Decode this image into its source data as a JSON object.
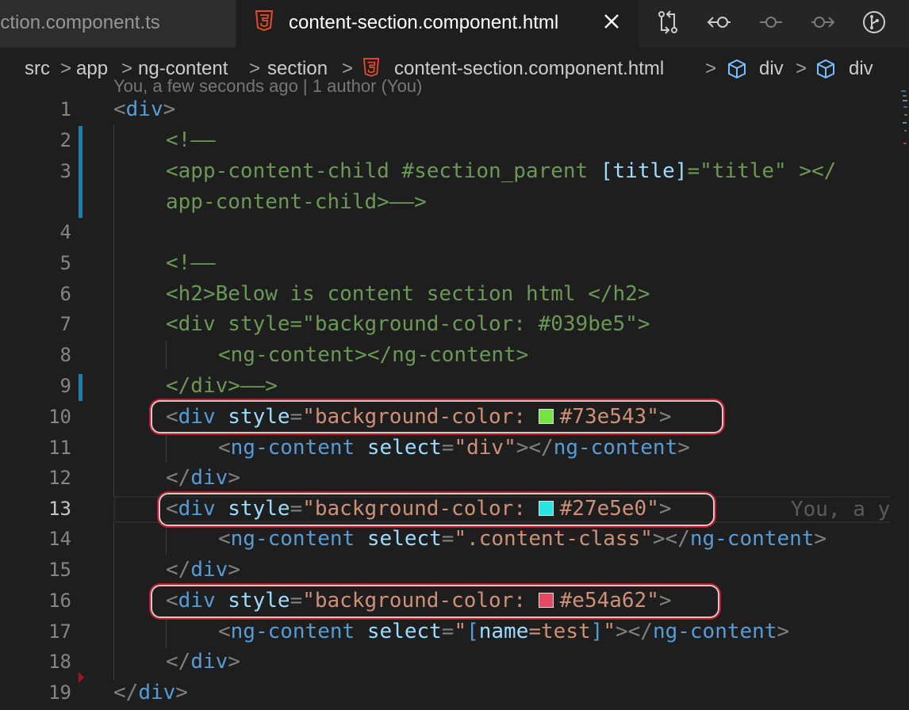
{
  "tabs": [
    {
      "label": "ection.component.ts",
      "active": false
    },
    {
      "label": "content-section.component.html",
      "active": true
    }
  ],
  "toolbar_icons": [
    "compare-changes-icon",
    "git-previous-icon",
    "git-commit-icon",
    "git-next-icon",
    "git-graph-icon"
  ],
  "breadcrumb": [
    "src",
    "app",
    "ng-content",
    "section",
    "content-section.component.html",
    "div",
    "div"
  ],
  "ghost_text": "You, a few seconds ago | 1 author (You)",
  "line_numbers": [
    "1",
    "2",
    "3",
    "",
    "4",
    "5",
    "6",
    "7",
    "8",
    "9",
    "10",
    "11",
    "12",
    "13",
    "14",
    "15",
    "16",
    "17",
    "18",
    "19"
  ],
  "code": {
    "l1_open": "<",
    "l1_tag": "div",
    "l1_close": ">",
    "l2": "<!——",
    "l3": "<app-content-child #section_parent ",
    "l3_attr": "[title]",
    "l3_rest": "=\"title\" ></",
    "l3b": "app-content-child>——>",
    "l5": "<!——",
    "l6": "<h2>Below is content section html </h2>",
    "l7": "<div style=\"background-color: #039be5\">",
    "l8": "<ng-content></ng-content>",
    "l9": "</div>——>",
    "l10_val": "#73e543",
    "l13_val": "#27e5e0",
    "l16_val": "#e54a62",
    "l11_sel": "div",
    "l14_sel": ".content-class",
    "l17_open": "[",
    "l17_name": "name",
    "l17_eq": "=test",
    "l17_close": "]",
    "bg_prefix": "background-color: ",
    "div": "div",
    "style": "style",
    "ng_content": "ng-content",
    "select": "select",
    "blame": "You, a y"
  },
  "colors": {
    "swatch_green": "#73e543",
    "swatch_cyan": "#27e5e0",
    "swatch_red": "#e54a62",
    "highlight_box": "#c0192e",
    "modified_bar": "#1b81a8"
  }
}
